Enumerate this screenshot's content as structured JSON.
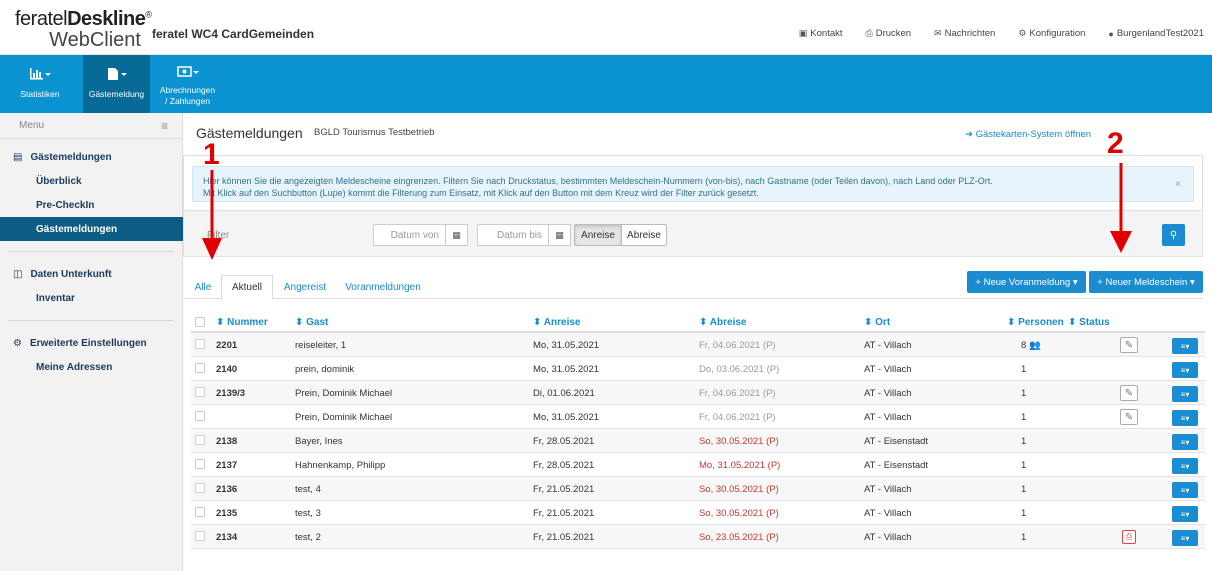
{
  "header": {
    "logo_line1_a": "feratel",
    "logo_line1_b": "Deskline",
    "logo_reg": "®",
    "logo_line2": "WebClient",
    "app_title": "feratel WC4 CardGemeinden",
    "nav": [
      {
        "label": "Kontakt",
        "icon": "contact-icon"
      },
      {
        "label": "Drucken",
        "icon": "print-icon"
      },
      {
        "label": "Nachrichten",
        "icon": "envelope-icon"
      },
      {
        "label": "Konfiguration",
        "icon": "gear-icon"
      },
      {
        "label": "BurgenlandTest2021",
        "icon": "user-icon"
      }
    ]
  },
  "bluenav": {
    "items": [
      {
        "label": "Statistiken",
        "icon": "bar-chart-icon"
      },
      {
        "label": "Gästemeldung",
        "icon": "document-icon"
      },
      {
        "label_line1": "Abrechnungen",
        "label_line2": "/ Zahlungen",
        "icon": "money-icon"
      }
    ]
  },
  "sidebar": {
    "menu_label": "Menu",
    "sections": [
      {
        "title": "Gästemeldungen",
        "items": [
          "Überblick",
          "Pre-CheckIn",
          "Gästemeldungen"
        ]
      },
      {
        "title": "Daten Unterkunft",
        "items": [
          "Inventar"
        ]
      },
      {
        "title": "Erweiterte Einstellungen",
        "items": [
          "Meine Adressen"
        ]
      }
    ]
  },
  "main": {
    "title": "Gästemeldungen",
    "subtitle": "BGLD Tourismus Testbetrieb",
    "ext_link": "Gästekarten-System öffnen",
    "info_line1": "Hier können Sie die angezeigten Meldescheine eingrenzen. Filtern Sie nach Druckstatus, bestimmten Meldeschein-Nummern (von-bis), nach Gastname (oder Teilen davon), nach Land oder PLZ-Ort.",
    "info_line2": "Mit Klick auf den Suchbutton (Lupe) kommt die Filterung zum Einsatz, mit Klick auf den Button mit dem Kreuz wird der Filter zurück gesetzt.",
    "filter_label": "Filter",
    "date_from_placeholder": "Datum von",
    "date_to_placeholder": "Datum bis",
    "seg_anreise": "Anreise",
    "seg_abreise": "Abreise",
    "tabs": [
      "Alle",
      "Aktuell",
      "Angereist",
      "Voranmeldungen"
    ],
    "btn_voranmeldung": "+ Neue Voranmeldung ▾",
    "btn_meldeschein": "+ Neuer Meldeschein ▾"
  },
  "table": {
    "headers": [
      "⬍ Nummer",
      "⬍ Gast",
      "⬍ Anreise",
      "⬍ Abreise",
      "⬍ Ort",
      "⬍ Personen",
      "⬍ Status"
    ],
    "rows": [
      {
        "nummer": "2201",
        "gast": "reiseleiter, 1",
        "anreise": "Mo, 31.05.2021",
        "abreise": "Fr, 04.06.2021 (P)",
        "abreise_style": "grey",
        "ort": "AT - Villach",
        "personen": "8",
        "group": true,
        "edit": true,
        "pdf": false
      },
      {
        "nummer": "2140",
        "gast": "prein, dominik",
        "anreise": "Mo, 31.05.2021",
        "abreise": "Do, 03.06.2021 (P)",
        "abreise_style": "grey",
        "ort": "AT - Villach",
        "personen": "1",
        "group": false,
        "edit": false,
        "pdf": false
      },
      {
        "nummer": "2139/3",
        "gast": "Prein, Dominik Michael",
        "anreise": "Di, 01.06.2021",
        "abreise": "Fr, 04.06.2021 (P)",
        "abreise_style": "grey",
        "ort": "AT - Villach",
        "personen": "1",
        "group": false,
        "edit": true,
        "pdf": false
      },
      {
        "nummer": "",
        "gast": "Prein, Dominik Michael",
        "anreise": "Mo, 31.05.2021",
        "abreise": "Fr, 04.06.2021 (P)",
        "abreise_style": "grey",
        "ort": "AT - Villach",
        "personen": "1",
        "group": false,
        "edit": true,
        "pdf": false
      },
      {
        "nummer": "2138",
        "gast": "Bayer, Ines",
        "anreise": "Fr, 28.05.2021",
        "abreise": "So, 30.05.2021 (P)",
        "abreise_style": "red",
        "ort": "AT - Eisenstadt",
        "personen": "1",
        "group": false,
        "edit": false,
        "pdf": false
      },
      {
        "nummer": "2137",
        "gast": "Hahnenkamp, Philipp",
        "anreise": "Fr, 28.05.2021",
        "abreise": "Mo, 31.05.2021 (P)",
        "abreise_style": "red",
        "ort": "AT - Eisenstadt",
        "personen": "1",
        "group": false,
        "edit": false,
        "pdf": false
      },
      {
        "nummer": "2136",
        "gast": "test, 4",
        "anreise": "Fr, 21.05.2021",
        "abreise": "So, 30.05.2021 (P)",
        "abreise_style": "red",
        "ort": "AT - Villach",
        "personen": "1",
        "group": false,
        "edit": false,
        "pdf": false
      },
      {
        "nummer": "2135",
        "gast": "test, 3",
        "anreise": "Fr, 21.05.2021",
        "abreise": "So, 30.05.2021 (P)",
        "abreise_style": "red",
        "ort": "AT - Villach",
        "personen": "1",
        "group": false,
        "edit": false,
        "pdf": false
      },
      {
        "nummer": "2134",
        "gast": "test, 2",
        "anreise": "Fr, 21.05.2021",
        "abreise": "So, 23.05.2021 (P)",
        "abreise_style": "red",
        "ort": "AT - Villach",
        "personen": "1",
        "group": false,
        "edit": false,
        "pdf": true
      }
    ]
  },
  "annotations": {
    "one": "1",
    "two": "2"
  },
  "colors": {
    "brand_blue": "#0b92d1",
    "nav_active": "#076a97",
    "link": "#1a8ccf",
    "annotation": "#e00000"
  }
}
